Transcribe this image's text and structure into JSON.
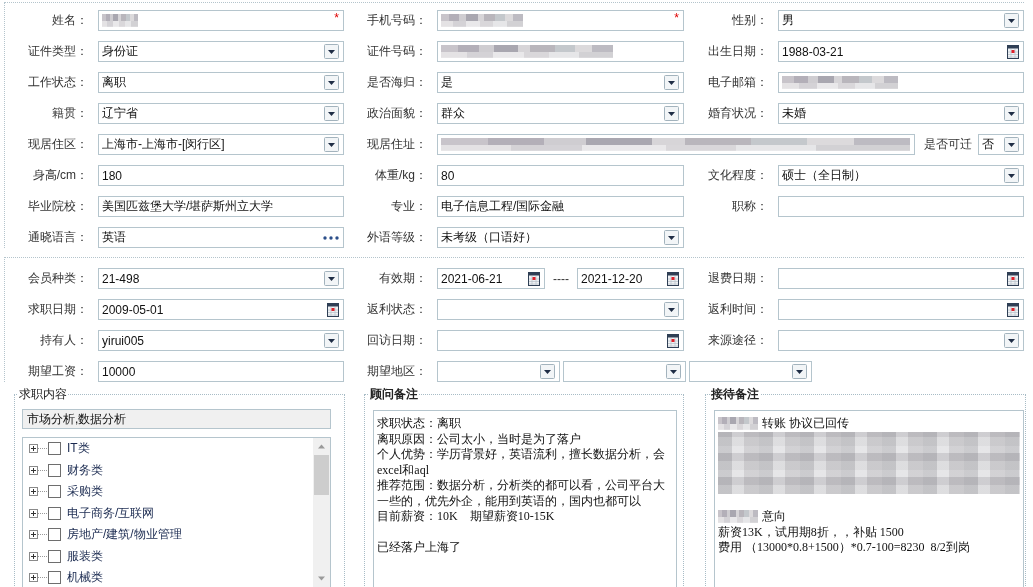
{
  "personal": {
    "rows": [
      [
        {
          "label": "姓名：",
          "kind": "text",
          "redacted": true,
          "required_mark": "*"
        },
        {
          "label": "手机号码：",
          "kind": "text",
          "redacted": true,
          "required_mark": "*"
        },
        {
          "label": "性别：",
          "kind": "select",
          "value": "男",
          "redacted": false
        }
      ],
      [
        {
          "label": "证件类型：",
          "kind": "select",
          "value": "身份证",
          "redacted": false
        },
        {
          "label": "证件号码：",
          "kind": "text",
          "redacted": true
        },
        {
          "label": "出生日期：",
          "kind": "date",
          "value": "1988-03-21",
          "redacted": false
        }
      ],
      [
        {
          "label": "工作状态：",
          "kind": "select",
          "value": "离职",
          "redacted": false
        },
        {
          "label": "是否海归：",
          "kind": "select",
          "value": "是",
          "redacted": false
        },
        {
          "label": "电子邮箱：",
          "kind": "text",
          "redacted": true
        }
      ],
      [
        {
          "label": "籍贯：",
          "kind": "select",
          "value": "辽宁省",
          "redacted": false
        },
        {
          "label": "政治面貌：",
          "kind": "select",
          "value": "群众",
          "redacted": false
        },
        {
          "label": "婚育状况：",
          "kind": "select",
          "value": "未婚",
          "redacted": false
        }
      ],
      [
        {
          "label": "现居住区：",
          "kind": "select",
          "value": "上海市-上海市-[闵行区]",
          "redacted": false
        },
        {
          "label": "现居住址：",
          "kind": "wide_text",
          "redacted": true
        },
        {
          "label": "是否可迁",
          "kind": "compact_select",
          "value": "否",
          "redacted": false
        }
      ],
      [
        {
          "label": "身高/cm：",
          "kind": "text",
          "value": "180",
          "redacted": false
        },
        {
          "label": "体重/kg：",
          "kind": "text",
          "value": "80",
          "redacted": false
        },
        {
          "label": "文化程度：",
          "kind": "select",
          "value": "硕士（全日制）",
          "redacted": false
        }
      ],
      [
        {
          "label": "毕业院校：",
          "kind": "text",
          "value": "美国匹兹堡大学/堪萨斯州立大学",
          "redacted": false
        },
        {
          "label": "专业：",
          "kind": "text",
          "value": "电子信息工程/国际金融",
          "redacted": false
        },
        {
          "label": "职称：",
          "kind": "text",
          "redacted": false
        }
      ],
      [
        {
          "label": "通晓语言：",
          "kind": "lookup",
          "value": "英语",
          "redacted": false
        },
        {
          "label": "外语等级：",
          "kind": "select",
          "value": "未考级（口语好）",
          "redacted": false
        }
      ]
    ]
  },
  "membership": {
    "rows": [
      [
        {
          "label": "会员种类：",
          "kind": "select",
          "value": "21-498"
        },
        {
          "label": "有效期：",
          "kind": "date_range",
          "from": "2021-06-21",
          "separator": "----",
          "to": "2021-12-20"
        },
        {
          "label": "退费日期：",
          "kind": "date"
        }
      ],
      [
        {
          "label": "求职日期：",
          "kind": "date",
          "value": "2009-05-01"
        },
        {
          "label": "返利状态：",
          "kind": "select"
        },
        {
          "label": "返利时间：",
          "kind": "date"
        }
      ],
      [
        {
          "label": "持有人：",
          "kind": "select",
          "value": "yirui005"
        },
        {
          "label": "回访日期：",
          "kind": "date"
        },
        {
          "label": "来源途径：",
          "kind": "select"
        }
      ],
      [
        {
          "label": "期望工资：",
          "kind": "text",
          "value": "10000"
        },
        {
          "label": "期望地区：",
          "kind": "multi_select",
          "parts": [
            {
              "kind": "select"
            },
            {
              "kind": "select"
            },
            {
              "kind": "select"
            }
          ]
        }
      ]
    ]
  },
  "job_intent": {
    "legend": "求职内容",
    "emphasized": false,
    "selected_text": "市场分析,数据分析",
    "categories": [
      {
        "label": "IT类",
        "expanded": false,
        "checked": false
      },
      {
        "label": "财务类",
        "expanded": false,
        "checked": false
      },
      {
        "label": "采购类",
        "expanded": false,
        "checked": false
      },
      {
        "label": "电子商务/互联网",
        "expanded": false,
        "checked": false
      },
      {
        "label": "房地产/建筑/物业管理",
        "expanded": false,
        "checked": false
      },
      {
        "label": "服装类",
        "expanded": false,
        "checked": false
      },
      {
        "label": "机械类",
        "expanded": false,
        "checked": false
      }
    ]
  },
  "advisor_notes": {
    "legend": "顾问备注",
    "emphasized": true,
    "lines": [
      {
        "kind": "text",
        "text": "求职状态：离职"
      },
      {
        "kind": "text",
        "text": "离职原因：公司太小，当时是为了落户"
      },
      {
        "kind": "text",
        "text": "个人优势：学历背景好，英语流利，擅长数据分析，会excel和aql"
      },
      {
        "kind": "text",
        "text": "推荐范围：数据分析，分析类的都可以看，公司平台大一些的，优先外企，能用到英语的，国内也都可以"
      },
      {
        "kind": "text",
        "text": "目前薪资：10K    期望薪资10-15K"
      },
      {
        "kind": "blank"
      },
      {
        "kind": "text",
        "text": "已经落户上海了"
      }
    ]
  },
  "reception_notes": {
    "legend": "接待备注",
    "emphasized": true,
    "lines": [
      {
        "kind": "redacted_prefix",
        "text": "转账 协议已回传"
      },
      {
        "kind": "redacted_block"
      },
      {
        "kind": "blank"
      },
      {
        "kind": "redacted_prefix",
        "text": "意向"
      },
      {
        "kind": "text",
        "text": "薪资13K，试用期8折，，补贴 1500"
      },
      {
        "kind": "text",
        "text": "费用 （13000*0.8+1500）*0.7-100=8230  8/2到岗"
      }
    ]
  }
}
